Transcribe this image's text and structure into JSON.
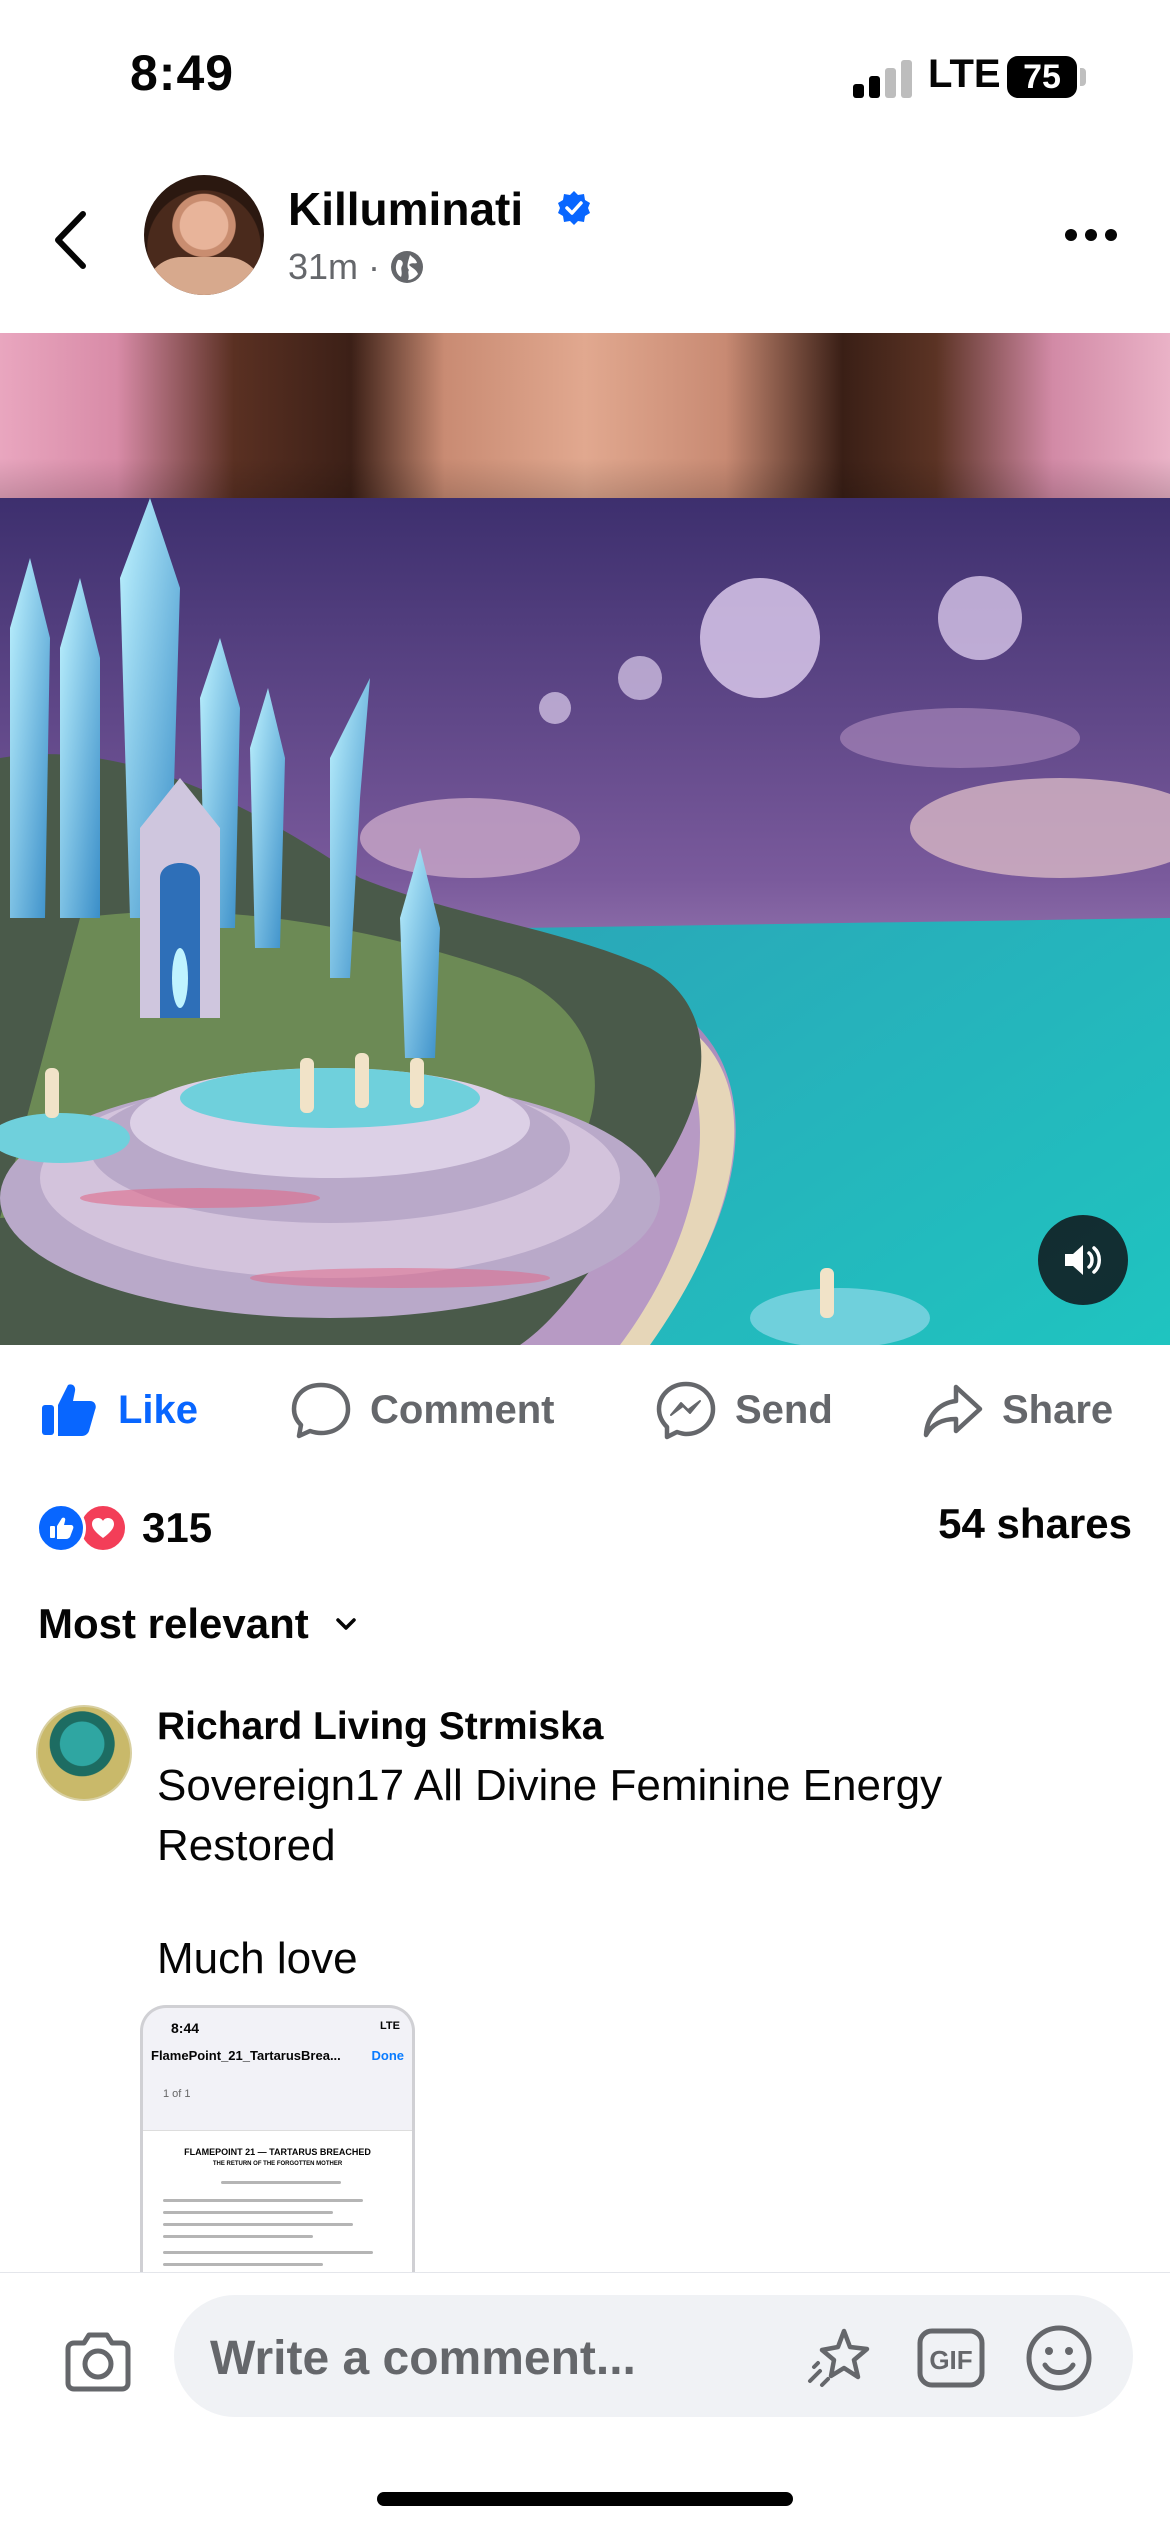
{
  "status_bar": {
    "time": "8:49",
    "network": "LTE",
    "battery": "75"
  },
  "post": {
    "author": "Killuminati",
    "time": "31m",
    "separator": "·"
  },
  "actions": {
    "like": "Like",
    "comment": "Comment",
    "send": "Send",
    "share": "Share"
  },
  "stats": {
    "reactions_count": "315",
    "shares": "54 shares"
  },
  "sort": {
    "label": "Most relevant"
  },
  "comment": {
    "author": "Richard Living Strmiska",
    "text": "Sovereign17 All Divine Feminine Energy Restored",
    "text2": "Much love",
    "attachment": {
      "time": "8:44",
      "network": "LTE",
      "title": "FlamePoint_21_TartarusBrea...",
      "done": "Done",
      "page": "1 of 1",
      "doc_title": "FLAMEPOINT 21 — TARTARUS BREACHED",
      "doc_subtitle": "THE RETURN OF THE FORGOTTEN MOTHER"
    }
  },
  "composer": {
    "placeholder": "Write a comment..."
  },
  "icons": {
    "back": "chevron-left-icon",
    "verified": "verified-badge-icon",
    "privacy": "globe-icon",
    "more": "more-horizontal-icon",
    "volume": "volume-icon",
    "camera": "camera-icon",
    "avatar_sticker": "sticker-icon",
    "gif": "gif-icon",
    "emoji": "emoji-icon"
  },
  "colors": {
    "accent": "#0866ff",
    "love": "#f33e58",
    "muted": "#65676b"
  }
}
